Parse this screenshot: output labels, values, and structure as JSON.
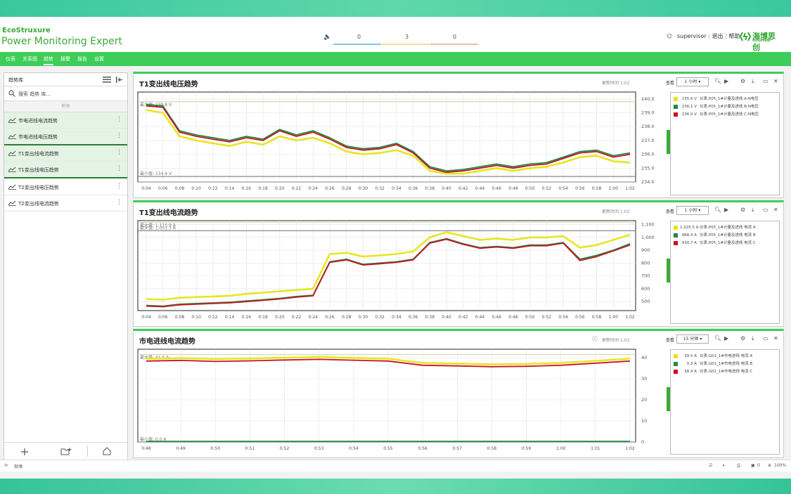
{
  "app": {
    "brand_line1": "EcoStruxure",
    "brand_line2": "Power Monitoring Expert",
    "user": "supervisor",
    "user_links": [
      "退出",
      "帮助"
    ],
    "partner_logo": "海博思创",
    "partner_logo_sub": "HIGHDE"
  },
  "alarm_counts": [
    "0",
    "3",
    "0"
  ],
  "nav": [
    "仪表",
    "关系图",
    "趋势",
    "报警",
    "报告",
    "设置"
  ],
  "sidebar": {
    "title": "趋势库",
    "search_placeholder": "搜索 趋势 库...",
    "group": "所有",
    "items": [
      {
        "label": "市电进线电流趋势"
      },
      {
        "label": "市电进线电压趋势"
      },
      {
        "label": "T1变出线电流趋势"
      },
      {
        "label": "T1变出线电压趋势"
      },
      {
        "label": "T2变出线电压趋势"
      },
      {
        "label": "T2变出线电流趋势"
      }
    ]
  },
  "status_bar": {
    "left": "就绪",
    "zoom": "100%",
    "count": "0"
  },
  "panels": [
    {
      "title": "T1变出线电压趋势",
      "updated": "更新时间 1:02",
      "range_label": "查看",
      "range": "1 小时",
      "max_label": "最大值: 239.8 V",
      "min_label": "最小值: 234.4 V",
      "legend": [
        {
          "value": "235.6 V",
          "name": "仪表.P05_1#计量及进线 A-N电压",
          "color": "#e6e620"
        },
        {
          "value": "236.1 V",
          "name": "仪表.P05_1#计量及进线 B-N电压",
          "color": "#1e8a46"
        },
        {
          "value": "236.0 V",
          "name": "仪表.P05_1#计量及进线 C-N电压",
          "color": "#c8141e"
        }
      ]
    },
    {
      "title": "T1变出线电流趋势",
      "updated": "更新时间 1:02",
      "range_label": "查看",
      "range": "1 小时",
      "max_label": "最大值: 1,115.9 A",
      "min_label": "最大值: 1,051.3 A",
      "legend": [
        {
          "value": "1,025.5 A",
          "name": "仪表.P05_1#计量及进线 电流 A",
          "color": "#e6e620"
        },
        {
          "value": "968.4 A",
          "name": "仪表.P05_1#计量及进线 电流 B",
          "color": "#1e8a46"
        },
        {
          "value": "930.7 A",
          "name": "仪表.P05_1#计量及进线 电流 C",
          "color": "#c8141e"
        }
      ]
    },
    {
      "title": "市电进线电流趋势",
      "updated": "更新时间 1:02",
      "range_label": "查看",
      "range": "15 分钟",
      "max_label": "最大值: 41.5 A",
      "min_label": "最小值: 0.0 A",
      "legend": [
        {
          "value": "39.5 A",
          "name": "仪表.G01_1#市电进线 电流 A",
          "color": "#e6e620"
        },
        {
          "value": "0.3 A",
          "name": "仪表.G01_1#市电进线 电流 B",
          "color": "#1e8a46"
        },
        {
          "value": "38.4 A",
          "name": "仪表.G01_1#市电进线 电流 C",
          "color": "#c8141e"
        }
      ]
    }
  ],
  "chart_data": [
    {
      "type": "line",
      "title": "T1变出线电压趋势",
      "x": [
        "0:04",
        "0:06",
        "0:08",
        "0:10",
        "0:12",
        "0:14",
        "0:16",
        "0:18",
        "0:20",
        "0:22",
        "0:24",
        "0:26",
        "0:28",
        "0:30",
        "0:32",
        "0:34",
        "0:36",
        "0:38",
        "0:40",
        "0:42",
        "0:44",
        "0:46",
        "0:48",
        "0:50",
        "0:52",
        "0:54",
        "0:56",
        "0:58",
        "1:00",
        "1:02"
      ],
      "yticks": [
        "240.0",
        "239.0",
        "238.0",
        "237.0",
        "236.0",
        "235.0",
        "234.0"
      ],
      "ylim": [
        234,
        240.5
      ],
      "reference_lines": [
        239.8,
        234.4
      ],
      "grid": true,
      "series": [
        {
          "name": "仪表.P05_1#计量及进线 A-N电压",
          "color": "#e6e620",
          "values": [
            239.2,
            239.0,
            237.3,
            237.0,
            236.8,
            236.6,
            236.9,
            236.7,
            237.3,
            237.0,
            237.2,
            236.8,
            236.2,
            236.0,
            236.1,
            236.3,
            235.9,
            234.8,
            234.6,
            234.6,
            234.8,
            235.0,
            234.8,
            235.0,
            235.1,
            235.4,
            235.8,
            235.9,
            235.5,
            235.4
          ]
        },
        {
          "name": "仪表.P05_1#计量及进线 B-N电压",
          "color": "#1e8a46",
          "values": [
            239.6,
            239.5,
            237.7,
            237.4,
            237.2,
            237.0,
            237.3,
            237.1,
            237.8,
            237.4,
            237.7,
            237.2,
            236.6,
            236.4,
            236.5,
            236.8,
            236.2,
            235.1,
            234.8,
            234.9,
            235.1,
            235.3,
            235.1,
            235.3,
            235.4,
            235.8,
            236.2,
            236.3,
            235.9,
            236.1
          ]
        },
        {
          "name": "仪表.P05_1#计量及进线 C-N电压",
          "color": "#c8141e",
          "values": [
            239.5,
            239.4,
            237.6,
            237.3,
            237.1,
            236.9,
            237.2,
            237.0,
            237.7,
            237.3,
            237.6,
            237.1,
            236.5,
            236.3,
            236.4,
            236.7,
            236.1,
            235.0,
            234.7,
            234.8,
            235.0,
            235.2,
            235.0,
            235.2,
            235.3,
            235.7,
            236.1,
            236.2,
            235.8,
            236.0
          ]
        }
      ]
    },
    {
      "type": "line",
      "title": "T1变出线电流趋势",
      "x": [
        "0:04",
        "0:06",
        "0:08",
        "0:10",
        "0:12",
        "0:14",
        "0:16",
        "0:18",
        "0:20",
        "0:22",
        "0:24",
        "0:26",
        "0:28",
        "0:30",
        "0:32",
        "0:34",
        "0:36",
        "0:38",
        "0:40",
        "0:42",
        "0:44",
        "0:46",
        "0:48",
        "0:50",
        "0:52",
        "0:54",
        "0:56",
        "0:58",
        "1:00",
        "1:02"
      ],
      "yticks": [
        "1,100",
        "1,000",
        "900",
        "800",
        "700",
        "600",
        "500"
      ],
      "ylim": [
        430,
        1130
      ],
      "reference_lines": [
        1115.9,
        1051.3
      ],
      "grid": true,
      "series": [
        {
          "name": "仪表.P05_1#计量及进线 电流 A",
          "color": "#e6e620",
          "values": [
            520,
            515,
            530,
            535,
            540,
            545,
            560,
            570,
            580,
            590,
            600,
            870,
            880,
            850,
            860,
            870,
            890,
            1000,
            1040,
            1010,
            980,
            990,
            980,
            1000,
            1000,
            1010,
            920,
            940,
            980,
            1020
          ]
        },
        {
          "name": "仪表.P05_1#计量及进线 电流 B",
          "color": "#1e8a46",
          "values": [
            470,
            465,
            480,
            485,
            490,
            495,
            505,
            515,
            525,
            540,
            550,
            810,
            830,
            790,
            800,
            810,
            830,
            960,
            990,
            950,
            920,
            930,
            920,
            940,
            940,
            960,
            830,
            860,
            900,
            950
          ]
        },
        {
          "name": "仪表.P05_1#计量及进线 电流 C",
          "color": "#c8141e",
          "values": [
            465,
            460,
            475,
            480,
            485,
            490,
            500,
            510,
            520,
            535,
            545,
            805,
            825,
            785,
            795,
            805,
            825,
            955,
            985,
            945,
            915,
            925,
            915,
            935,
            935,
            955,
            820,
            850,
            895,
            940
          ]
        }
      ]
    },
    {
      "type": "line",
      "title": "市电进线电流趋势",
      "x": [
        "0:48",
        "0:49",
        "0:50",
        "0:51",
        "0:52",
        "0:53",
        "0:54",
        "0:55",
        "0:56",
        "0:57",
        "0:58",
        "0:59",
        "1:00",
        "1:01",
        "1:02"
      ],
      "yticks": [
        "40",
        "30",
        "20",
        "10",
        "0"
      ],
      "ylim": [
        0,
        44
      ],
      "reference_lines": [
        41.5,
        0.0
      ],
      "grid": true,
      "series": [
        {
          "name": "仪表.G01_1#市电进线 电流 A",
          "color": "#e6e620",
          "values": [
            39.5,
            39.8,
            39.3,
            39.6,
            40.0,
            40.3,
            39.9,
            39.5,
            37.5,
            37.2,
            36.8,
            37.0,
            37.5,
            38.5,
            39.5
          ]
        },
        {
          "name": "仪表.G01_1#市电进线 电流 B",
          "color": "#1e8a46",
          "values": [
            0.3,
            0.3,
            0.3,
            0.3,
            0.3,
            0.3,
            0.3,
            0.3,
            0.3,
            0.3,
            0.3,
            0.3,
            0.3,
            0.3,
            0.3
          ]
        },
        {
          "name": "仪表.G01_1#市电进线 电流 C",
          "color": "#c8141e",
          "values": [
            38.4,
            38.7,
            38.2,
            38.5,
            38.9,
            39.2,
            38.8,
            38.4,
            36.4,
            36.1,
            35.7,
            35.9,
            36.4,
            37.4,
            38.4
          ]
        }
      ]
    }
  ]
}
